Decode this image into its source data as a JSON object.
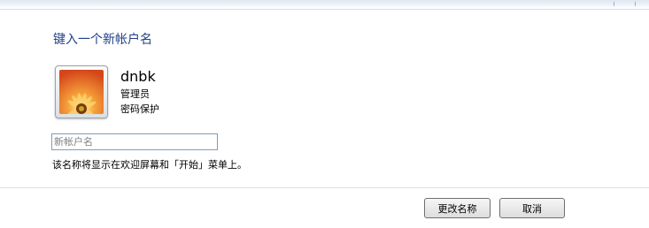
{
  "dialog": {
    "heading": "键入一个新帐户名"
  },
  "account": {
    "username": "dnbk",
    "role": "管理员",
    "protection": "密码保护",
    "avatar_icon": "flower-picture-icon"
  },
  "rename": {
    "placeholder": "新帐户名",
    "value": "",
    "hint": "该名称将显示在欢迎屏幕和「开始」菜单上。"
  },
  "buttons": {
    "rename_label": "更改名称",
    "cancel_label": "取消"
  },
  "colors": {
    "heading": "#1f3f87",
    "input_border": "#7f9db9"
  }
}
